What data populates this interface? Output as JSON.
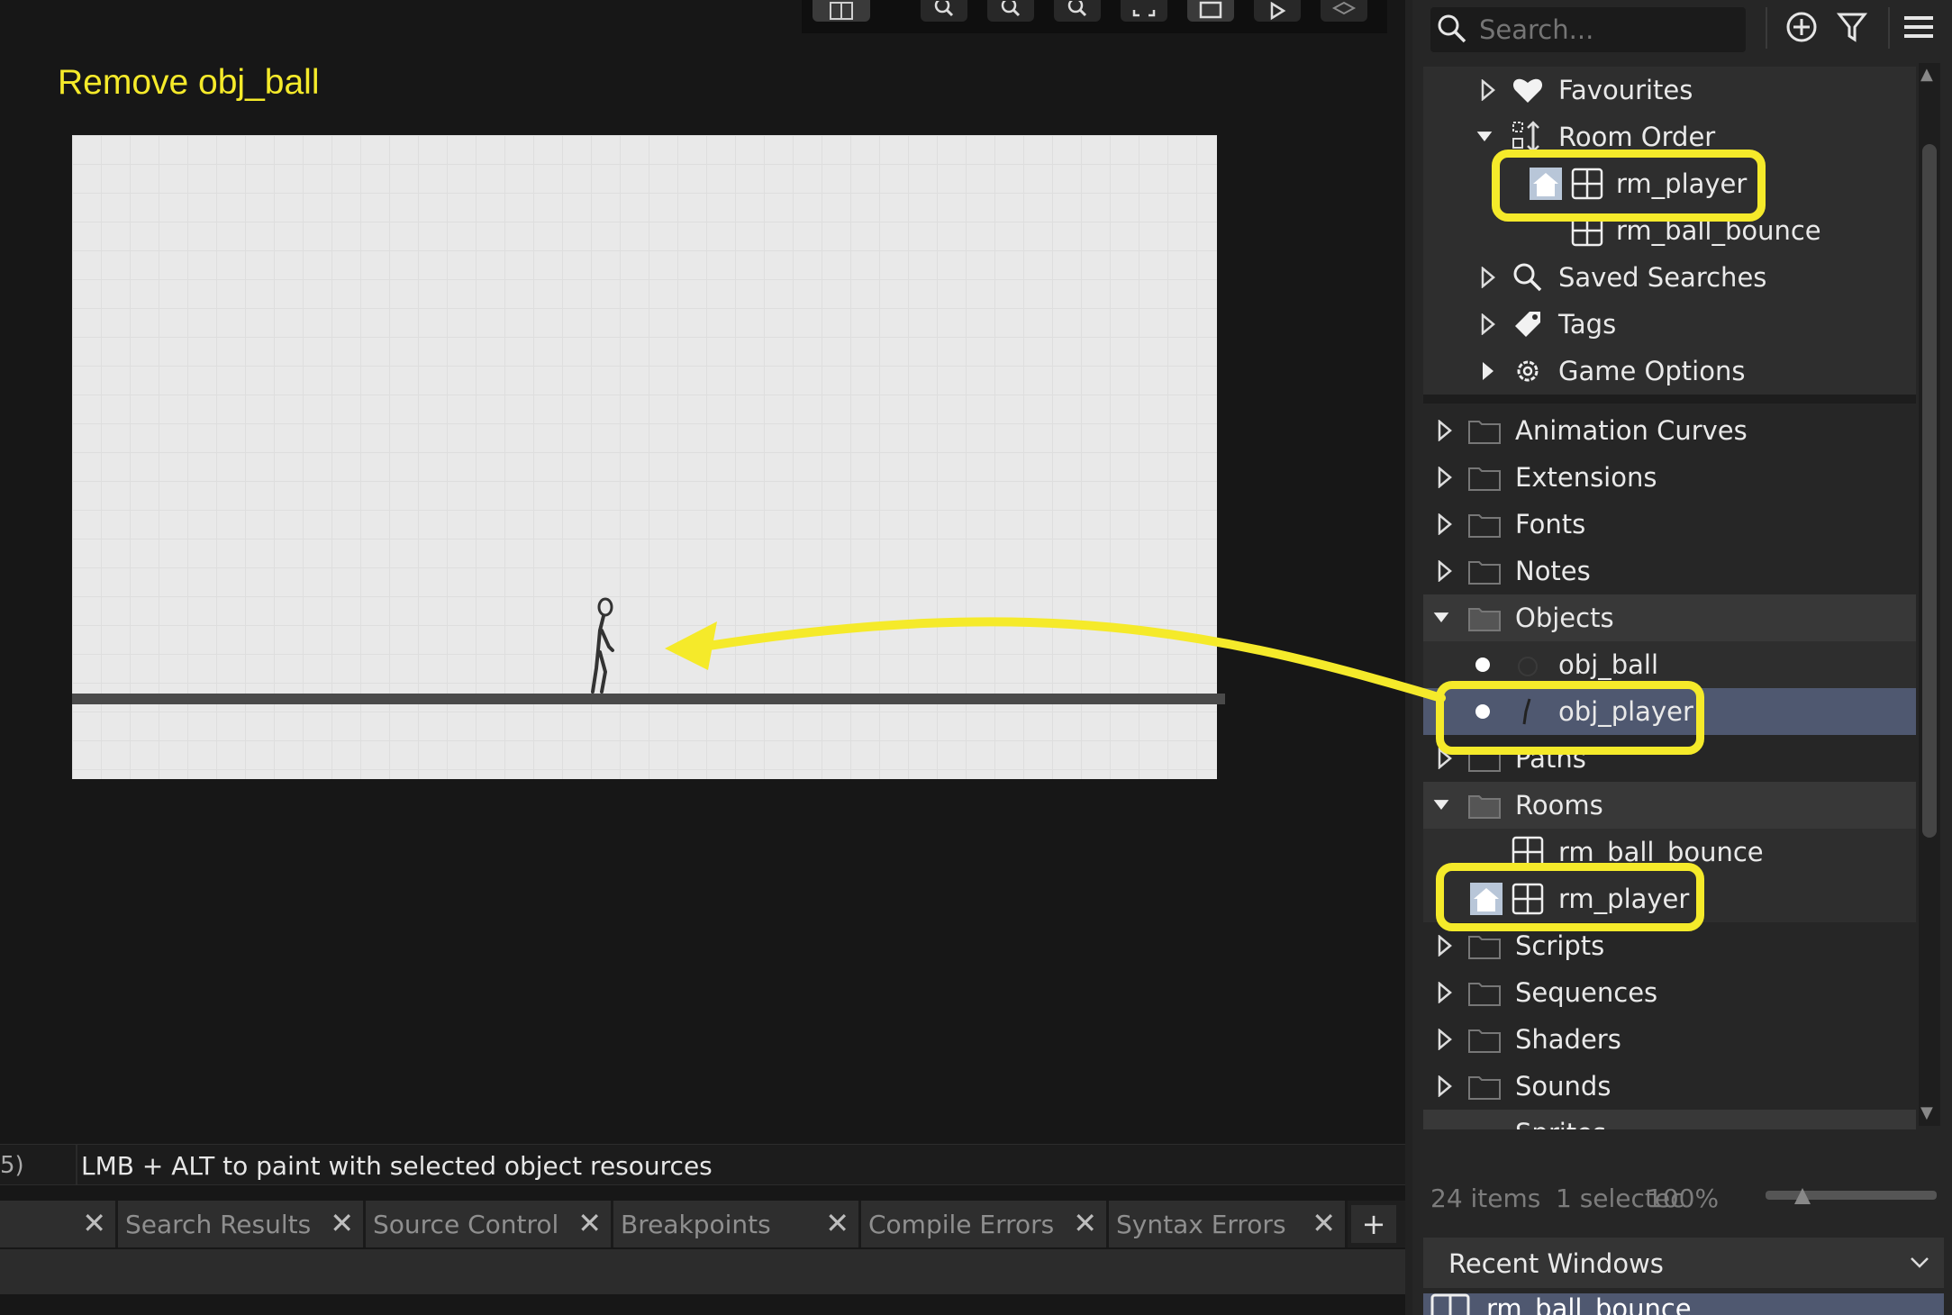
{
  "annotation": {
    "title": "Remove obj_ball"
  },
  "status": {
    "prefix": "5)",
    "hint": "LMB + ALT to paint with selected object resources"
  },
  "output_tabs": [
    {
      "label": ""
    },
    {
      "label": "Search Results"
    },
    {
      "label": "Source Control"
    },
    {
      "label": "Breakpoints"
    },
    {
      "label": "Compile Errors"
    },
    {
      "label": "Syntax Errors"
    }
  ],
  "tab_add_label": "+",
  "asset_browser": {
    "search_placeholder": "Search...",
    "tree": {
      "favourites": "Favourites",
      "room_order": "Room Order",
      "room_order_first": "rm_player",
      "room_order_second": "rm_ball_bounce",
      "saved_searches": "Saved Searches",
      "tags": "Tags",
      "game_options": "Game Options",
      "animation_curves": "Animation Curves",
      "extensions": "Extensions",
      "fonts": "Fonts",
      "notes": "Notes",
      "objects": "Objects",
      "obj_ball": "obj_ball",
      "obj_player": "obj_player",
      "paths": "Paths",
      "rooms": "Rooms",
      "rm_ball_bounce": "rm_ball_bounce",
      "rm_player": "rm_player",
      "scripts": "Scripts",
      "sequences": "Sequences",
      "shaders": "Shaders",
      "sounds": "Sounds",
      "sprites_partial": "Sprites"
    },
    "footer": {
      "count": "24 items",
      "selected": "1 selectec",
      "zoom": "100%"
    }
  },
  "recent_windows": {
    "title": "Recent Windows",
    "item": "rm_ball_bounce"
  },
  "colors": {
    "highlight": "#f5ea2a",
    "selection": "#4f5870",
    "background": "#161616"
  }
}
